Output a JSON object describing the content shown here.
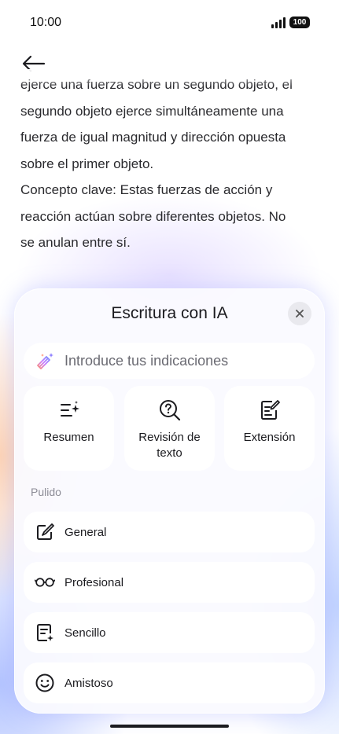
{
  "status_bar": {
    "time": "10:00",
    "battery": "100"
  },
  "content": {
    "text": "ejerce una fuerza sobre un segundo objeto, el\nsegundo objeto ejerce simultáneamente una\nfuerza de igual magnitud y dirección opuesta\nsobre el primer objeto.\nConcepto clave: Estas fuerzas de acción y\nreacción actúan sobre diferentes objetos. No\nse anulan entre sí."
  },
  "panel": {
    "title": "Escritura con IA",
    "prompt_placeholder": "Introduce tus indicaciones",
    "actions": [
      {
        "label": "Resumen",
        "icon": "summary-sparkle-icon"
      },
      {
        "label": "Revisión de\ntexto",
        "icon": "search-question-icon"
      },
      {
        "label": "Extensión",
        "icon": "edit-document-icon"
      }
    ],
    "section_label": "Pulido",
    "polish_items": [
      {
        "label": "General",
        "icon": "pen-icon"
      },
      {
        "label": "Profesional",
        "icon": "glasses-icon"
      },
      {
        "label": "Sencillo",
        "icon": "simple-document-icon"
      },
      {
        "label": "Amistoso",
        "icon": "smile-icon"
      }
    ]
  },
  "colors": {
    "accent_glow_blue": "#7896ff",
    "accent_glow_orange": "#ffb278",
    "panel_bg": "#fafaff"
  }
}
